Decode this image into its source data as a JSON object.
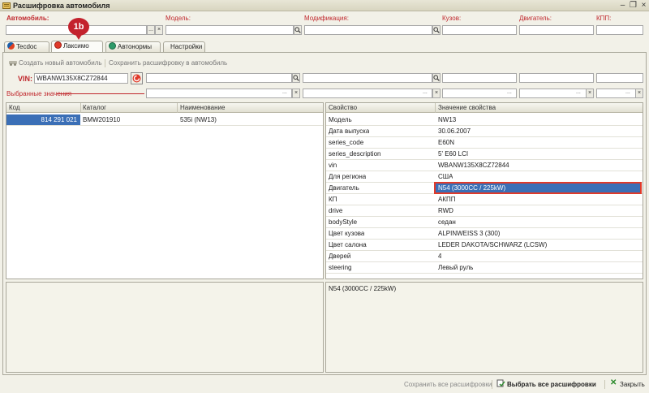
{
  "window": {
    "title": "Расшифровка автомобиля"
  },
  "header": {
    "labels": {
      "car": "Автомобиль:",
      "model": "Модель:",
      "modification": "Модификация:",
      "body": "Кузов:",
      "engine": "Двигатель:",
      "gearbox": "КПП:"
    },
    "dots": "...",
    "clear": "×"
  },
  "callout": {
    "text": "1b"
  },
  "tabs": [
    {
      "label": "Tecdoc"
    },
    {
      "label": "Лаксимо"
    },
    {
      "label": "Автонормы"
    },
    {
      "label": "Настройки"
    }
  ],
  "toolbar": {
    "create_car": "Создать новый автомобиль",
    "save_decode": "Сохранить расшифровку в автомобиль"
  },
  "vin": {
    "label": "VIN:",
    "value": "WBANW135X8CZ72844"
  },
  "selected_values": {
    "label": "Выбранные значения"
  },
  "left_grid": {
    "headers": [
      "Код",
      "Каталог",
      "Наименование"
    ],
    "rows": [
      {
        "code": "814 291 021",
        "catalog": "BMW201910",
        "name": "535i (NW13)"
      }
    ]
  },
  "right_grid": {
    "headers": [
      "Свойство",
      "Значение свойства"
    ],
    "rows": [
      {
        "prop": "Модель",
        "value": "NW13"
      },
      {
        "prop": "Дата выпуска",
        "value": "30.06.2007"
      },
      {
        "prop": "series_code",
        "value": "E60N"
      },
      {
        "prop": "series_description",
        "value": "5' E60 LCI"
      },
      {
        "prop": "vin",
        "value": "WBANW135X8CZ72844"
      },
      {
        "prop": "Для региона",
        "value": "США"
      },
      {
        "prop": "Двигатель",
        "value": "N54 (3000CC / 225kW)"
      },
      {
        "prop": "КП",
        "value": "АКПП"
      },
      {
        "prop": "drive",
        "value": "RWD"
      },
      {
        "prop": "bodyStyle",
        "value": "седан"
      },
      {
        "prop": "Цвет кузова",
        "value": "ALPINWEISS 3 (300)"
      },
      {
        "prop": "Цвет салона",
        "value": "LEDER DAKOTA/SCHWARZ  (LCSW)"
      },
      {
        "prop": "Дверей",
        "value": "4"
      },
      {
        "prop": "steering",
        "value": "Левый руль"
      }
    ]
  },
  "detail": {
    "text": "N54 (3000CC / 225kW)"
  },
  "footer": {
    "save_all": "Сохранить все расшифровки",
    "select_all": "Выбрать все расшифровки",
    "close": "Закрыть"
  },
  "colors": {
    "accent_red": "#c0282d",
    "selection_blue": "#3b6fb6"
  }
}
